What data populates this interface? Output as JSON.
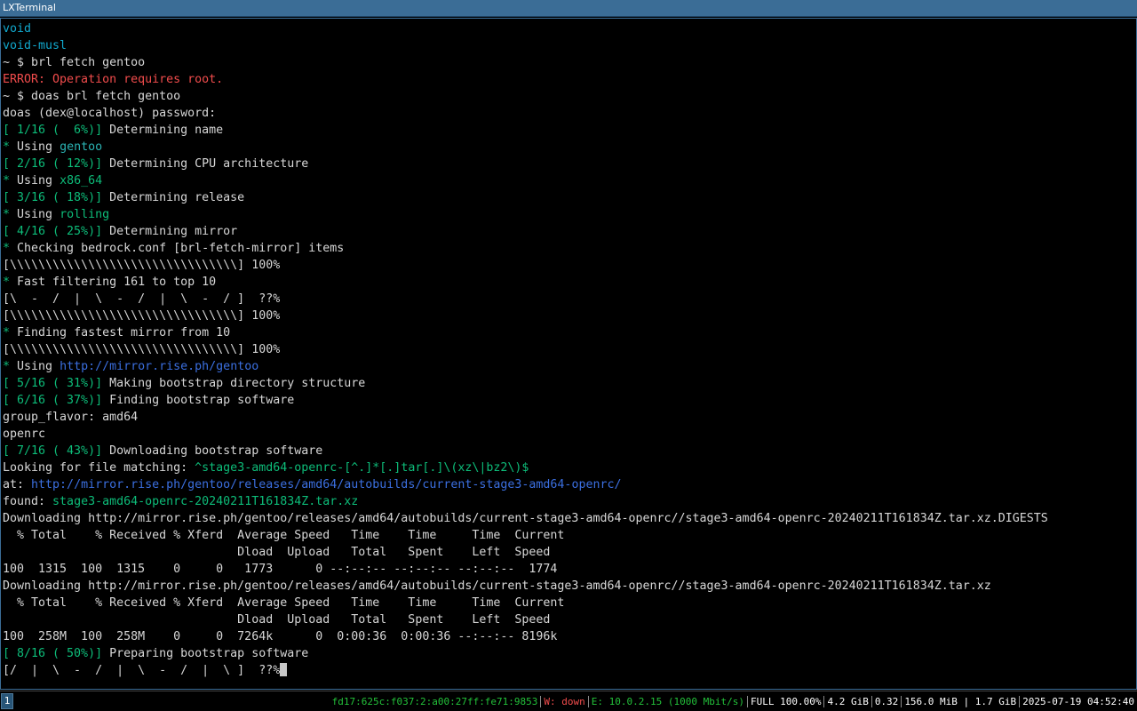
{
  "window": {
    "title": "LXTerminal"
  },
  "terminal": {
    "lines": [
      [
        {
          "t": "void",
          "c": "cyan"
        }
      ],
      [
        {
          "t": "void-musl",
          "c": "cyan"
        }
      ],
      [
        {
          "t": "~ $ brl fetch gentoo",
          "c": "default"
        }
      ],
      [
        {
          "t": "ERROR: Operation requires root.",
          "c": "red"
        }
      ],
      [
        {
          "t": "~ $ doas brl fetch gentoo",
          "c": "default"
        }
      ],
      [
        {
          "t": "doas (dex@localhost) password:",
          "c": "default"
        }
      ],
      [
        {
          "t": "[ 1/16 (  6%)]",
          "c": "green"
        },
        {
          "t": " Determining name",
          "c": "default"
        }
      ],
      [
        {
          "t": "*",
          "c": "green"
        },
        {
          "t": " Using ",
          "c": "default"
        },
        {
          "t": "gentoo",
          "c": "teal"
        }
      ],
      [
        {
          "t": "[ 2/16 ( 12%)]",
          "c": "green"
        },
        {
          "t": " Determining CPU architecture",
          "c": "default"
        }
      ],
      [
        {
          "t": "*",
          "c": "green"
        },
        {
          "t": " Using ",
          "c": "default"
        },
        {
          "t": "x86_64",
          "c": "green"
        }
      ],
      [
        {
          "t": "[ 3/16 ( 18%)]",
          "c": "green"
        },
        {
          "t": " Determining release",
          "c": "default"
        }
      ],
      [
        {
          "t": "*",
          "c": "green"
        },
        {
          "t": " Using ",
          "c": "default"
        },
        {
          "t": "rolling",
          "c": "green"
        }
      ],
      [
        {
          "t": "[ 4/16 ( 25%)]",
          "c": "green"
        },
        {
          "t": " Determining mirror",
          "c": "default"
        }
      ],
      [
        {
          "t": "*",
          "c": "green"
        },
        {
          "t": " Checking bedrock.conf [brl-fetch-mirror] items",
          "c": "default"
        }
      ],
      [
        {
          "t": "[\\\\\\\\\\\\\\\\\\\\\\\\\\\\\\\\\\\\\\\\\\\\\\\\\\\\\\\\\\\\\\\\] 100%",
          "c": "default"
        }
      ],
      [
        {
          "t": "*",
          "c": "green"
        },
        {
          "t": " Fast filtering 161 to top 10",
          "c": "default"
        }
      ],
      [
        {
          "t": "[\\  -  /  |  \\  -  /  |  \\  -  / ]  ??%",
          "c": "default"
        }
      ],
      [
        {
          "t": "[\\\\\\\\\\\\\\\\\\\\\\\\\\\\\\\\\\\\\\\\\\\\\\\\\\\\\\\\\\\\\\\\] 100%",
          "c": "default"
        }
      ],
      [
        {
          "t": "*",
          "c": "green"
        },
        {
          "t": " Finding fastest mirror from 10",
          "c": "default"
        }
      ],
      [
        {
          "t": "[\\\\\\\\\\\\\\\\\\\\\\\\\\\\\\\\\\\\\\\\\\\\\\\\\\\\\\\\\\\\\\\\] 100%",
          "c": "default"
        }
      ],
      [
        {
          "t": "*",
          "c": "green"
        },
        {
          "t": " Using ",
          "c": "default"
        },
        {
          "t": "http://mirror.rise.ph/gentoo",
          "c": "blue"
        }
      ],
      [
        {
          "t": "[ 5/16 ( 31%)]",
          "c": "green"
        },
        {
          "t": " Making bootstrap directory structure",
          "c": "default"
        }
      ],
      [
        {
          "t": "[ 6/16 ( 37%)]",
          "c": "green"
        },
        {
          "t": " Finding bootstrap software",
          "c": "default"
        }
      ],
      [
        {
          "t": "group_flavor: amd64",
          "c": "default"
        }
      ],
      [
        {
          "t": "openrc",
          "c": "default"
        }
      ],
      [
        {
          "t": "[ 7/16 ( 43%)]",
          "c": "green"
        },
        {
          "t": " Downloading bootstrap software",
          "c": "default"
        }
      ],
      [
        {
          "t": "Looking for file matching: ",
          "c": "default"
        },
        {
          "t": "^stage3-amd64-openrc-[^.]*[.]tar[.]\\(xz\\|bz2\\)$",
          "c": "green"
        }
      ],
      [
        {
          "t": "at: ",
          "c": "default"
        },
        {
          "t": "http://mirror.rise.ph/gentoo/releases/amd64/autobuilds/current-stage3-amd64-openrc/",
          "c": "blue"
        }
      ],
      [
        {
          "t": "found: ",
          "c": "default"
        },
        {
          "t": "stage3-amd64-openrc-20240211T161834Z.tar.xz",
          "c": "green"
        }
      ],
      [
        {
          "t": "Downloading http://mirror.rise.ph/gentoo/releases/amd64/autobuilds/current-stage3-amd64-openrc//stage3-amd64-openrc-20240211T161834Z.tar.xz.DIGESTS",
          "c": "default"
        }
      ],
      [
        {
          "t": "  % Total    % Received % Xferd  Average Speed   Time    Time     Time  Current",
          "c": "default"
        }
      ],
      [
        {
          "t": "                                 Dload  Upload   Total   Spent    Left  Speed",
          "c": "default"
        }
      ],
      [
        {
          "t": "100  1315  100  1315    0     0   1773      0 --:--:-- --:--:-- --:--:--  1774",
          "c": "default"
        }
      ],
      [
        {
          "t": "Downloading http://mirror.rise.ph/gentoo/releases/amd64/autobuilds/current-stage3-amd64-openrc//stage3-amd64-openrc-20240211T161834Z.tar.xz",
          "c": "default"
        }
      ],
      [
        {
          "t": "  % Total    % Received % Xferd  Average Speed   Time    Time     Time  Current",
          "c": "default"
        }
      ],
      [
        {
          "t": "                                 Dload  Upload   Total   Spent    Left  Speed",
          "c": "default"
        }
      ],
      [
        {
          "t": "100  258M  100  258M    0     0  7264k      0  0:00:36  0:00:36 --:--:-- 8196k",
          "c": "default"
        }
      ],
      [
        {
          "t": "[ 8/16 ( 50%)]",
          "c": "green"
        },
        {
          "t": " Preparing bootstrap software",
          "c": "default"
        }
      ],
      [
        {
          "t": "[/  |  \\  -  /  |  \\  -  /  |  \\ ]  ??%",
          "c": "default"
        }
      ]
    ]
  },
  "statusbar": {
    "workspace": "1",
    "segments": [
      {
        "text": "fd17:625c:f037:2:a00:27ff:fe71:9853",
        "color": "#23c13a"
      },
      {
        "text": "W: down",
        "color": "#f14c4c"
      },
      {
        "text": "E: 10.0.2.15 (1000 Mbit/s)",
        "color": "#23c13a"
      },
      {
        "text": "FULL 100.00%",
        "color": "#ffffff"
      },
      {
        "text": "4.2 GiB",
        "color": "#ffffff"
      },
      {
        "text": "0.32",
        "color": "#ffffff"
      },
      {
        "text": "156.0 MiB | 1.7 GiB",
        "color": "#ffffff"
      },
      {
        "text": "2025-07-19 04:52:40",
        "color": "#ffffff"
      }
    ]
  }
}
